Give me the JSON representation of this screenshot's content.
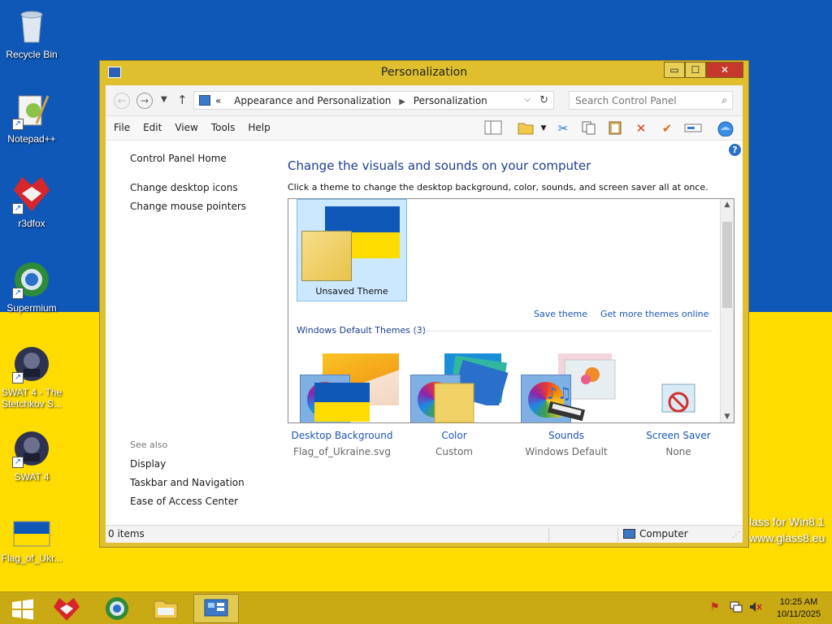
{
  "desktop": {
    "icons": [
      {
        "label": "Recycle Bin",
        "icon": "recycle-bin-icon"
      },
      {
        "label": "Notepad++",
        "icon": "notepad-plus-plus-icon"
      },
      {
        "label": "r3dfox",
        "icon": "r3dfox-icon"
      },
      {
        "label": "Supermium",
        "icon": "supermium-icon"
      },
      {
        "label": "SWAT 4 - The Stetchkov S...",
        "icon": "swat4-stetchkov-icon"
      },
      {
        "label": "SWAT 4",
        "icon": "swat4-icon"
      },
      {
        "label": "Flag_of_Ukr...",
        "icon": "ukraine-flag-file-icon"
      }
    ],
    "watermark_line1": "lass for Win8.1",
    "watermark_line2": "www.glass8.eu",
    "colors": {
      "flag_blue": "#0f58b8",
      "flag_yellow": "#fedc00"
    }
  },
  "window": {
    "title": "Personalization",
    "controls": {
      "minimize": "▭",
      "maximize": "☐",
      "close": "✕"
    },
    "address": {
      "prefix": "«",
      "crumbs": [
        "Appearance and Personalization",
        "Personalization"
      ]
    },
    "search_placeholder": "Search Control Panel",
    "menu": [
      "File",
      "Edit",
      "View",
      "Tools",
      "Help"
    ],
    "left_pane": {
      "home": "Control Panel Home",
      "links": [
        "Change desktop icons",
        "Change mouse pointers"
      ],
      "see_also_title": "See also",
      "see_also": [
        "Display",
        "Taskbar and Navigation",
        "Ease of Access Center"
      ]
    },
    "main": {
      "heading": "Change the visuals and sounds on your computer",
      "subheading": "Click a theme to change the desktop background, color, sounds, and screen saver all at once.",
      "selected_theme": "Unsaved Theme",
      "save_theme": "Save theme",
      "get_more": "Get more themes online",
      "group_header": "Windows Default Themes (3)"
    },
    "settings": [
      {
        "name": "Desktop Background",
        "value": "Flag_of_Ukraine.svg",
        "icon": "desktop-background-icon"
      },
      {
        "name": "Color",
        "value": "Custom",
        "icon": "color-swatch-icon"
      },
      {
        "name": "Sounds",
        "value": "Windows Default",
        "icon": "sounds-icon"
      },
      {
        "name": "Screen Saver",
        "value": "None",
        "icon": "screen-saver-icon"
      }
    ],
    "status": {
      "items": "0 items",
      "location": "Computer"
    }
  },
  "taskbar": {
    "clock_time": "10:25 AM",
    "clock_date": "10/11/2025"
  }
}
